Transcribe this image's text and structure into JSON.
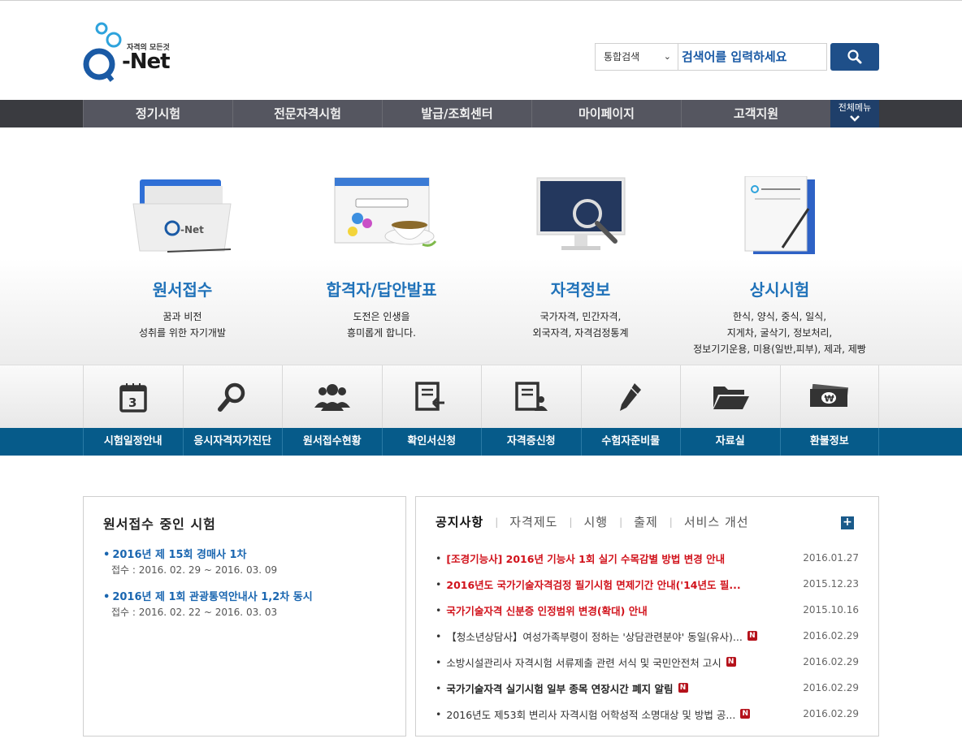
{
  "header": {
    "logo_tag": "자격의 모든것",
    "logo_text": "-Net",
    "search_scope": "통합검색",
    "search_placeholder": "검색어를 입력하세요"
  },
  "gnb": {
    "items": [
      "정기시험",
      "전문자격시험",
      "발급/조회센터",
      "마이페이지",
      "고객지원"
    ],
    "all_menu": "전체메뉴"
  },
  "hero": {
    "cards": [
      {
        "title": "원서접수",
        "line1": "꿈과 비전",
        "line2": "성취를 위한 자기개발"
      },
      {
        "title": "합격자/답안발표",
        "line1": "도전은 인생을",
        "line2": "흥미롭게 합니다."
      },
      {
        "title": "자격정보",
        "line1": "국가자격, 민간자격,",
        "line2": "외국자격, 자격검정통계"
      },
      {
        "title": "상시시험",
        "line1": "한식, 양식, 중식, 일식,",
        "line2": "지게차, 굴삭기, 정보처리,",
        "line3": "정보기기운용, 미용(일반,피부), 제과, 제빵"
      }
    ]
  },
  "quick": {
    "items": [
      {
        "label": "시험일정안내",
        "icon": "calendar-icon",
        "num": "3"
      },
      {
        "label": "응시자격자가진단",
        "icon": "magnifier-icon"
      },
      {
        "label": "원서접수현황",
        "icon": "people-icon"
      },
      {
        "label": "확인서신청",
        "icon": "document-arrow-icon"
      },
      {
        "label": "자격증신청",
        "icon": "document-person-icon"
      },
      {
        "label": "수험자준비물",
        "icon": "pencil-icon"
      },
      {
        "label": "자료실",
        "icon": "folder-icon"
      },
      {
        "label": "환불정보",
        "icon": "money-icon",
        "currency": "₩"
      }
    ]
  },
  "exams": {
    "title": "원서접수 중인 시험",
    "items": [
      {
        "name": "2016년 제 15회 경매사 1차",
        "period": "접수 : 2016. 02. 29 ~ 2016. 03. 09"
      },
      {
        "name": "2016년 제 1회 관광통역안내사 1,2차 동시",
        "period": "접수 : 2016. 02. 22 ~ 2016. 03. 03"
      }
    ]
  },
  "notice": {
    "tabs": [
      "공지사항",
      "자격제도",
      "시행",
      "출제",
      "서비스 개선"
    ],
    "more": "+",
    "new_badge": "N",
    "items": [
      {
        "title": "[조경기능사] 2016년 기능사 1회 실기 수목감별 방법 변경 안내",
        "date": "2016.01.27",
        "style": "red",
        "new": false
      },
      {
        "title": "2016년도 국가기술자격검정 필기시험 면제기간 안내('14년도 필...",
        "date": "2015.12.23",
        "style": "red",
        "new": false
      },
      {
        "title": "국가기술자격 신분증 인정범위 변경(확대) 안내",
        "date": "2015.10.16",
        "style": "red",
        "new": false
      },
      {
        "title": "【청소년상담사】여성가족부령이 정하는 '상담관련분야' 동일(유사)...",
        "date": "2016.02.29",
        "style": "norm",
        "new": true
      },
      {
        "title": "소방시설관리사 자격시험 서류제출 관련 서식 및 국민안전처 고시",
        "date": "2016.02.29",
        "style": "norm",
        "new": true
      },
      {
        "title": "국가기술자격 실기시험 일부 종목 연장시간 폐지 알림",
        "date": "2016.02.29",
        "style": "dark",
        "new": true
      },
      {
        "title": "2016년도 제53회 변리사 자격시험 어학성적 소명대상 및 방법 공...",
        "date": "2016.02.29",
        "style": "norm",
        "new": true
      }
    ]
  }
}
